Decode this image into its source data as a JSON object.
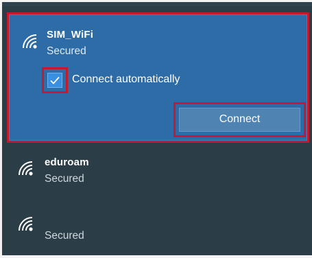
{
  "networks": [
    {
      "name": "SIM_WiFi",
      "status": "Secured",
      "icon": "wifi-signal-icon",
      "selected": true,
      "connect_automatically": {
        "label": "Connect automatically",
        "checked": true
      },
      "connect_button": {
        "label": "Connect"
      }
    },
    {
      "name": "eduroam",
      "status": "Secured",
      "icon": "wifi-signal-icon",
      "selected": false
    },
    {
      "name": "",
      "status": "Secured",
      "icon": "wifi-signal-icon",
      "selected": false
    }
  ],
  "colors": {
    "panel_background": "#2b3d47",
    "selected_background": "#2d6ca7",
    "highlight_border": "#c41a2c",
    "checkbox_fill": "#3b8fe0",
    "connect_button": "#4f84b2"
  }
}
